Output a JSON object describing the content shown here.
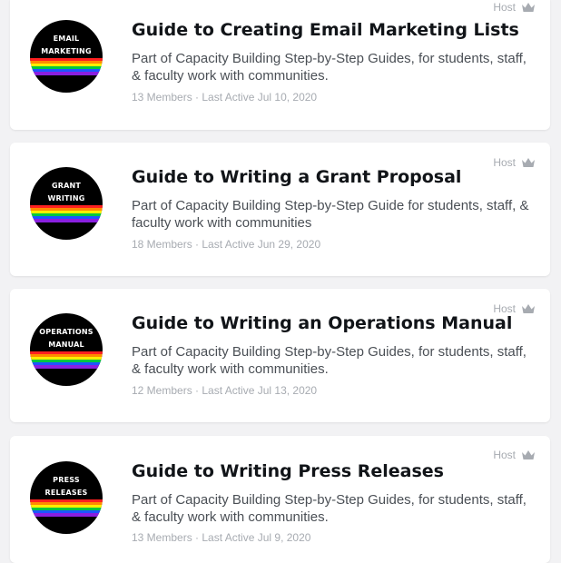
{
  "groups": [
    {
      "avatar_line1": "EMAIL",
      "avatar_line2": "MARKETING",
      "title": "Guide to Creating Email Marketing Lists",
      "description": "Part of Capacity Building Step-by-Step Guides, for students, staff, & faculty work with communities.",
      "meta": "13 Members · Last Active Jul 10, 2020",
      "role": "Host"
    },
    {
      "avatar_line1": "GRANT",
      "avatar_line2": "WRITING",
      "title": "Guide to Writing a Grant Proposal",
      "description": "Part of Capacity Building Step-by-Step Guide for students, staff, & faculty work with communities",
      "meta": "18 Members · Last Active Jun 29, 2020",
      "role": "Host"
    },
    {
      "avatar_line1": "OPERATIONS",
      "avatar_line2": "MANUAL",
      "title": "Guide to Writing an Operations Manual",
      "description": "Part of Capacity Building Step-by-Step Guides, for students, staff, & faculty work with communities.",
      "meta": "12 Members · Last Active Jul 13, 2020",
      "role": "Host"
    },
    {
      "avatar_line1": "PRESS",
      "avatar_line2": "RELEASES",
      "title": "Guide to Writing Press Releases",
      "description": "Part of Capacity Building Step-by-Step Guides, for students, staff, & faculty work with communities.",
      "meta": "13 Members · Last Active Jul 9, 2020",
      "role": "Host"
    }
  ],
  "icons": {
    "role": "crown-icon"
  },
  "colors": {
    "muted_text": "#a7abb1",
    "title": "#111418",
    "card_bg": "#ffffff",
    "page_bg": "#f2f2f4"
  }
}
